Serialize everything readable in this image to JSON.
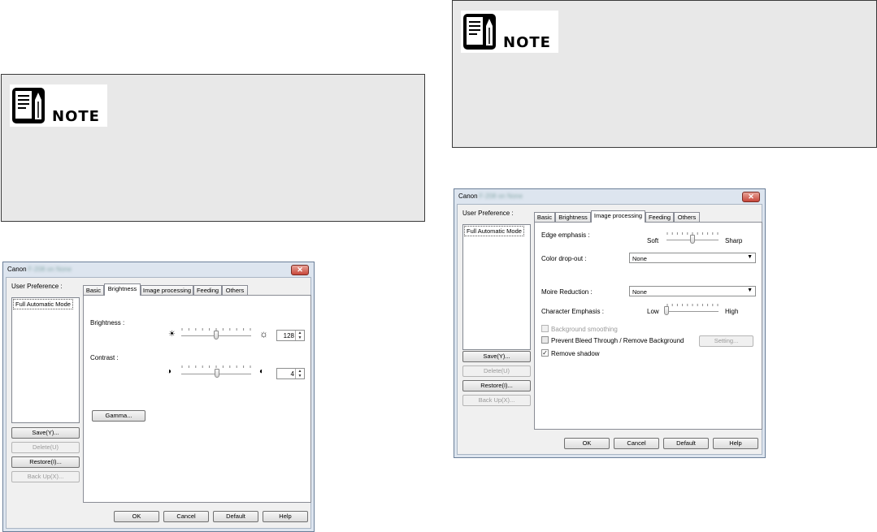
{
  "note": {
    "label": "NOTE"
  },
  "left_dialog": {
    "title": "Canon",
    "title_blurred": "F-208 on None",
    "close": "✕",
    "user_pref_label": "User Preference :",
    "list_items": [
      "Full Automatic Mode"
    ],
    "side_buttons": {
      "save": "Save(Y)...",
      "delete": "Delete(U)",
      "restore": "Restore(I)...",
      "backup": "Back Up(X)..."
    },
    "tabs": [
      "Basic",
      "Brightness",
      "Image processing",
      "Feeding",
      "Others"
    ],
    "active_tab": "Brightness",
    "brightness_label": "Brightness :",
    "brightness_value": "128",
    "brightness_level": 128,
    "contrast_label": "Contrast :",
    "contrast_value": "4",
    "contrast_level": 4,
    "gamma_button": "Gamma...",
    "bottom_buttons": {
      "ok": "OK",
      "cancel": "Cancel",
      "default": "Default",
      "help": "Help"
    }
  },
  "right_dialog": {
    "title": "Canon",
    "title_blurred": "F-208 on None",
    "close": "✕",
    "user_pref_label": "User Preference :",
    "list_items": [
      "Full Automatic Mode"
    ],
    "side_buttons": {
      "save": "Save(Y)...",
      "delete": "Delete(U)",
      "restore": "Restore(I)...",
      "backup": "Back Up(X)..."
    },
    "tabs": [
      "Basic",
      "Brightness",
      "Image processing",
      "Feeding",
      "Others"
    ],
    "active_tab": "Image processing",
    "edge_emphasis_label": "Edge emphasis :",
    "edge_soft": "Soft",
    "edge_sharp": "Sharp",
    "edge_level": 0.5,
    "color_dropout_label": "Color drop-out :",
    "color_dropout_value": "None",
    "moire_label": "Moire Reduction :",
    "moire_value": "None",
    "char_emphasis_label": "Character Emphasis :",
    "char_low": "Low",
    "char_high": "High",
    "char_level": 0.0,
    "background_smoothing": "Background smoothing",
    "prevent_bleed": "Prevent Bleed Through / Remove Background",
    "setting_button": "Setting...",
    "remove_shadow": "Remove shadow",
    "remove_shadow_checked": "✓",
    "bottom_buttons": {
      "ok": "OK",
      "cancel": "Cancel",
      "default": "Default",
      "help": "Help"
    }
  },
  "colors": {
    "note_bg": "#e8e8e8",
    "dialog_frame": "#dde5ef",
    "close_red": "#c7463a"
  }
}
